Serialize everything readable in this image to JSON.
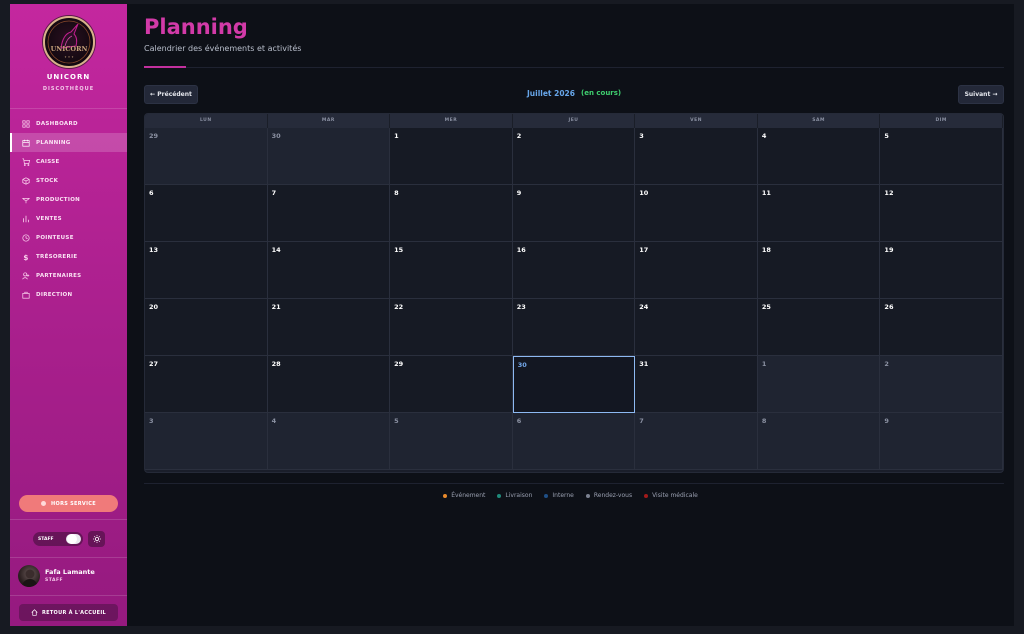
{
  "brand": {
    "name": "UNICORN",
    "subtitle": "DISCOTHÈQUE",
    "logo_text": "UNICORN"
  },
  "nav": [
    {
      "label": "DASHBOARD",
      "icon": "grid-icon",
      "active": false
    },
    {
      "label": "PLANNING",
      "icon": "calendar-icon",
      "active": true
    },
    {
      "label": "CAISSE",
      "icon": "cart-icon",
      "active": false
    },
    {
      "label": "STOCK",
      "icon": "box-icon",
      "active": false
    },
    {
      "label": "PRODUCTION",
      "icon": "cocktail-icon",
      "active": false
    },
    {
      "label": "VENTES",
      "icon": "bar-chart-icon",
      "active": false
    },
    {
      "label": "POINTEUSE",
      "icon": "clock-icon",
      "active": false
    },
    {
      "label": "TRÉSORERIE",
      "icon": "dollar-icon",
      "active": false
    },
    {
      "label": "PARTENAIRES",
      "icon": "user-plus-icon",
      "active": false
    },
    {
      "label": "DIRECTION",
      "icon": "briefcase-icon",
      "active": false
    }
  ],
  "status": {
    "label": "HORS SERVICE"
  },
  "role_toggle": {
    "label": "STAFF"
  },
  "user": {
    "name": "Fafa Lamante",
    "role": "STAFF"
  },
  "home_button": {
    "label": "RETOUR À L'ACCUEIL"
  },
  "page": {
    "title": "Planning",
    "subtitle": "Calendrier des événements et activités"
  },
  "calendar": {
    "prev_label": "← Précédent",
    "next_label": "Suivant →",
    "month_label": "Juillet 2026",
    "month_status": "(en cours)",
    "weekdays": [
      "LUN",
      "MAR",
      "MER",
      "JEU",
      "VEN",
      "SAM",
      "DIM"
    ],
    "days": [
      {
        "n": "29",
        "other": true
      },
      {
        "n": "30",
        "other": true
      },
      {
        "n": "1"
      },
      {
        "n": "2"
      },
      {
        "n": "3"
      },
      {
        "n": "4"
      },
      {
        "n": "5"
      },
      {
        "n": "6"
      },
      {
        "n": "7"
      },
      {
        "n": "8"
      },
      {
        "n": "9"
      },
      {
        "n": "10"
      },
      {
        "n": "11"
      },
      {
        "n": "12"
      },
      {
        "n": "13"
      },
      {
        "n": "14"
      },
      {
        "n": "15"
      },
      {
        "n": "16"
      },
      {
        "n": "17"
      },
      {
        "n": "18"
      },
      {
        "n": "19"
      },
      {
        "n": "20"
      },
      {
        "n": "21"
      },
      {
        "n": "22"
      },
      {
        "n": "23"
      },
      {
        "n": "24"
      },
      {
        "n": "25"
      },
      {
        "n": "26"
      },
      {
        "n": "27"
      },
      {
        "n": "28"
      },
      {
        "n": "29"
      },
      {
        "n": "30",
        "today": true
      },
      {
        "n": "31"
      },
      {
        "n": "1",
        "other": true
      },
      {
        "n": "2",
        "other": true
      },
      {
        "n": "3",
        "other": true
      },
      {
        "n": "4",
        "other": true
      },
      {
        "n": "5",
        "other": true
      },
      {
        "n": "6",
        "other": true
      },
      {
        "n": "7",
        "other": true
      },
      {
        "n": "8",
        "other": true
      },
      {
        "n": "9",
        "other": true
      }
    ]
  },
  "legend": [
    {
      "label": "Événement",
      "color": "#e8892b"
    },
    {
      "label": "Livraison",
      "color": "#1f8a7a"
    },
    {
      "label": "Interne",
      "color": "#1f4f86"
    },
    {
      "label": "Rendez-vous",
      "color": "#7b8190"
    },
    {
      "label": "Visite médicale",
      "color": "#a11a1a"
    }
  ]
}
